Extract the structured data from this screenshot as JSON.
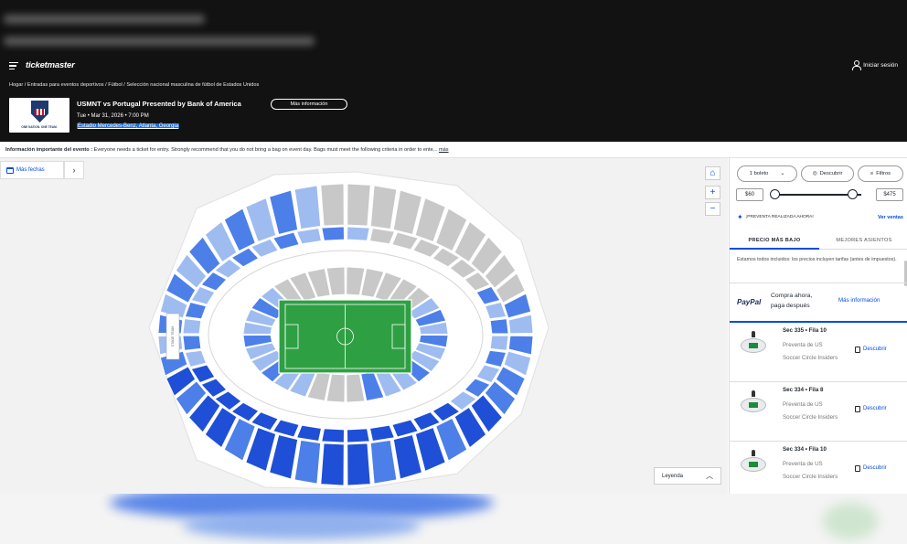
{
  "header": {
    "logo": "ticketmaster",
    "signin": "Iniciar sesión",
    "breadcrumb": "Hogar / Entradas para eventos deportivos / Fútbol / Selección nacional masculina de fútbol de Estados Unidos",
    "event_title": "USMNT vs Portugal Presented by Bank of America",
    "more_info": "Más información",
    "event_date": "Tue • Mar 31, 2026 • 7:00 PM",
    "venue": "Estadio Mercedes-Benz, Atlanta, Georgia",
    "logo_caption": "ONE NATION. ONE TEAM."
  },
  "notice": {
    "label": "Información importante del evento :",
    "text": "Everyone needs a ticket for entry. Strongly recommend that you do not bring a bag on event day. Bags must meet the following criteria in order to ente...",
    "more": "más"
  },
  "map": {
    "more_dates": "Más fechas",
    "legend": "Leyenda",
    "home_icon": "home-icon",
    "zoom_in": "+",
    "zoom_out": "−",
    "stage_label": "STAGE TEAM"
  },
  "filters": {
    "quantity": "1 boleto",
    "discover": "Descubrir",
    "filters": "Filtros",
    "price_min": "$60",
    "price_max": "$475",
    "presale_text": "¡PREVENTA REALIZADA AHORA!",
    "see_sales": "Ver ventas"
  },
  "tabs": {
    "lowest": "PRECIO MÁS BAJO",
    "best": "MEJORES ASIENTOS"
  },
  "taxes_note": "Estamos todos incluidos: los precios incluyen tarifas (antes de impuestos).",
  "paypal": {
    "logo": "PayPal",
    "line1": "Compra ahora,",
    "line2": "paga después",
    "more": "Más información"
  },
  "tickets": [
    {
      "section": "Sec 335 • Fila 10",
      "desc": "Preventa de US Soccer Circle Insiders",
      "cta": "Descubrir"
    },
    {
      "section": "Sec 334 • Fila 8",
      "desc": "Preventa de US Soccer Circle Insiders",
      "cta": "Descubrir"
    },
    {
      "section": "Sec 334 • Fila 10",
      "desc": "Preventa de US Soccer Circle Insiders",
      "cta": "Descubrir"
    }
  ],
  "colors": {
    "header_bg": "#121212",
    "accent": "#024ddf",
    "section_dark": "#1f4fd6",
    "section_mid": "#4d7fe8",
    "section_light": "#9fbcf1",
    "section_gray": "#c8c8c8",
    "pitch": "#2ea043"
  }
}
